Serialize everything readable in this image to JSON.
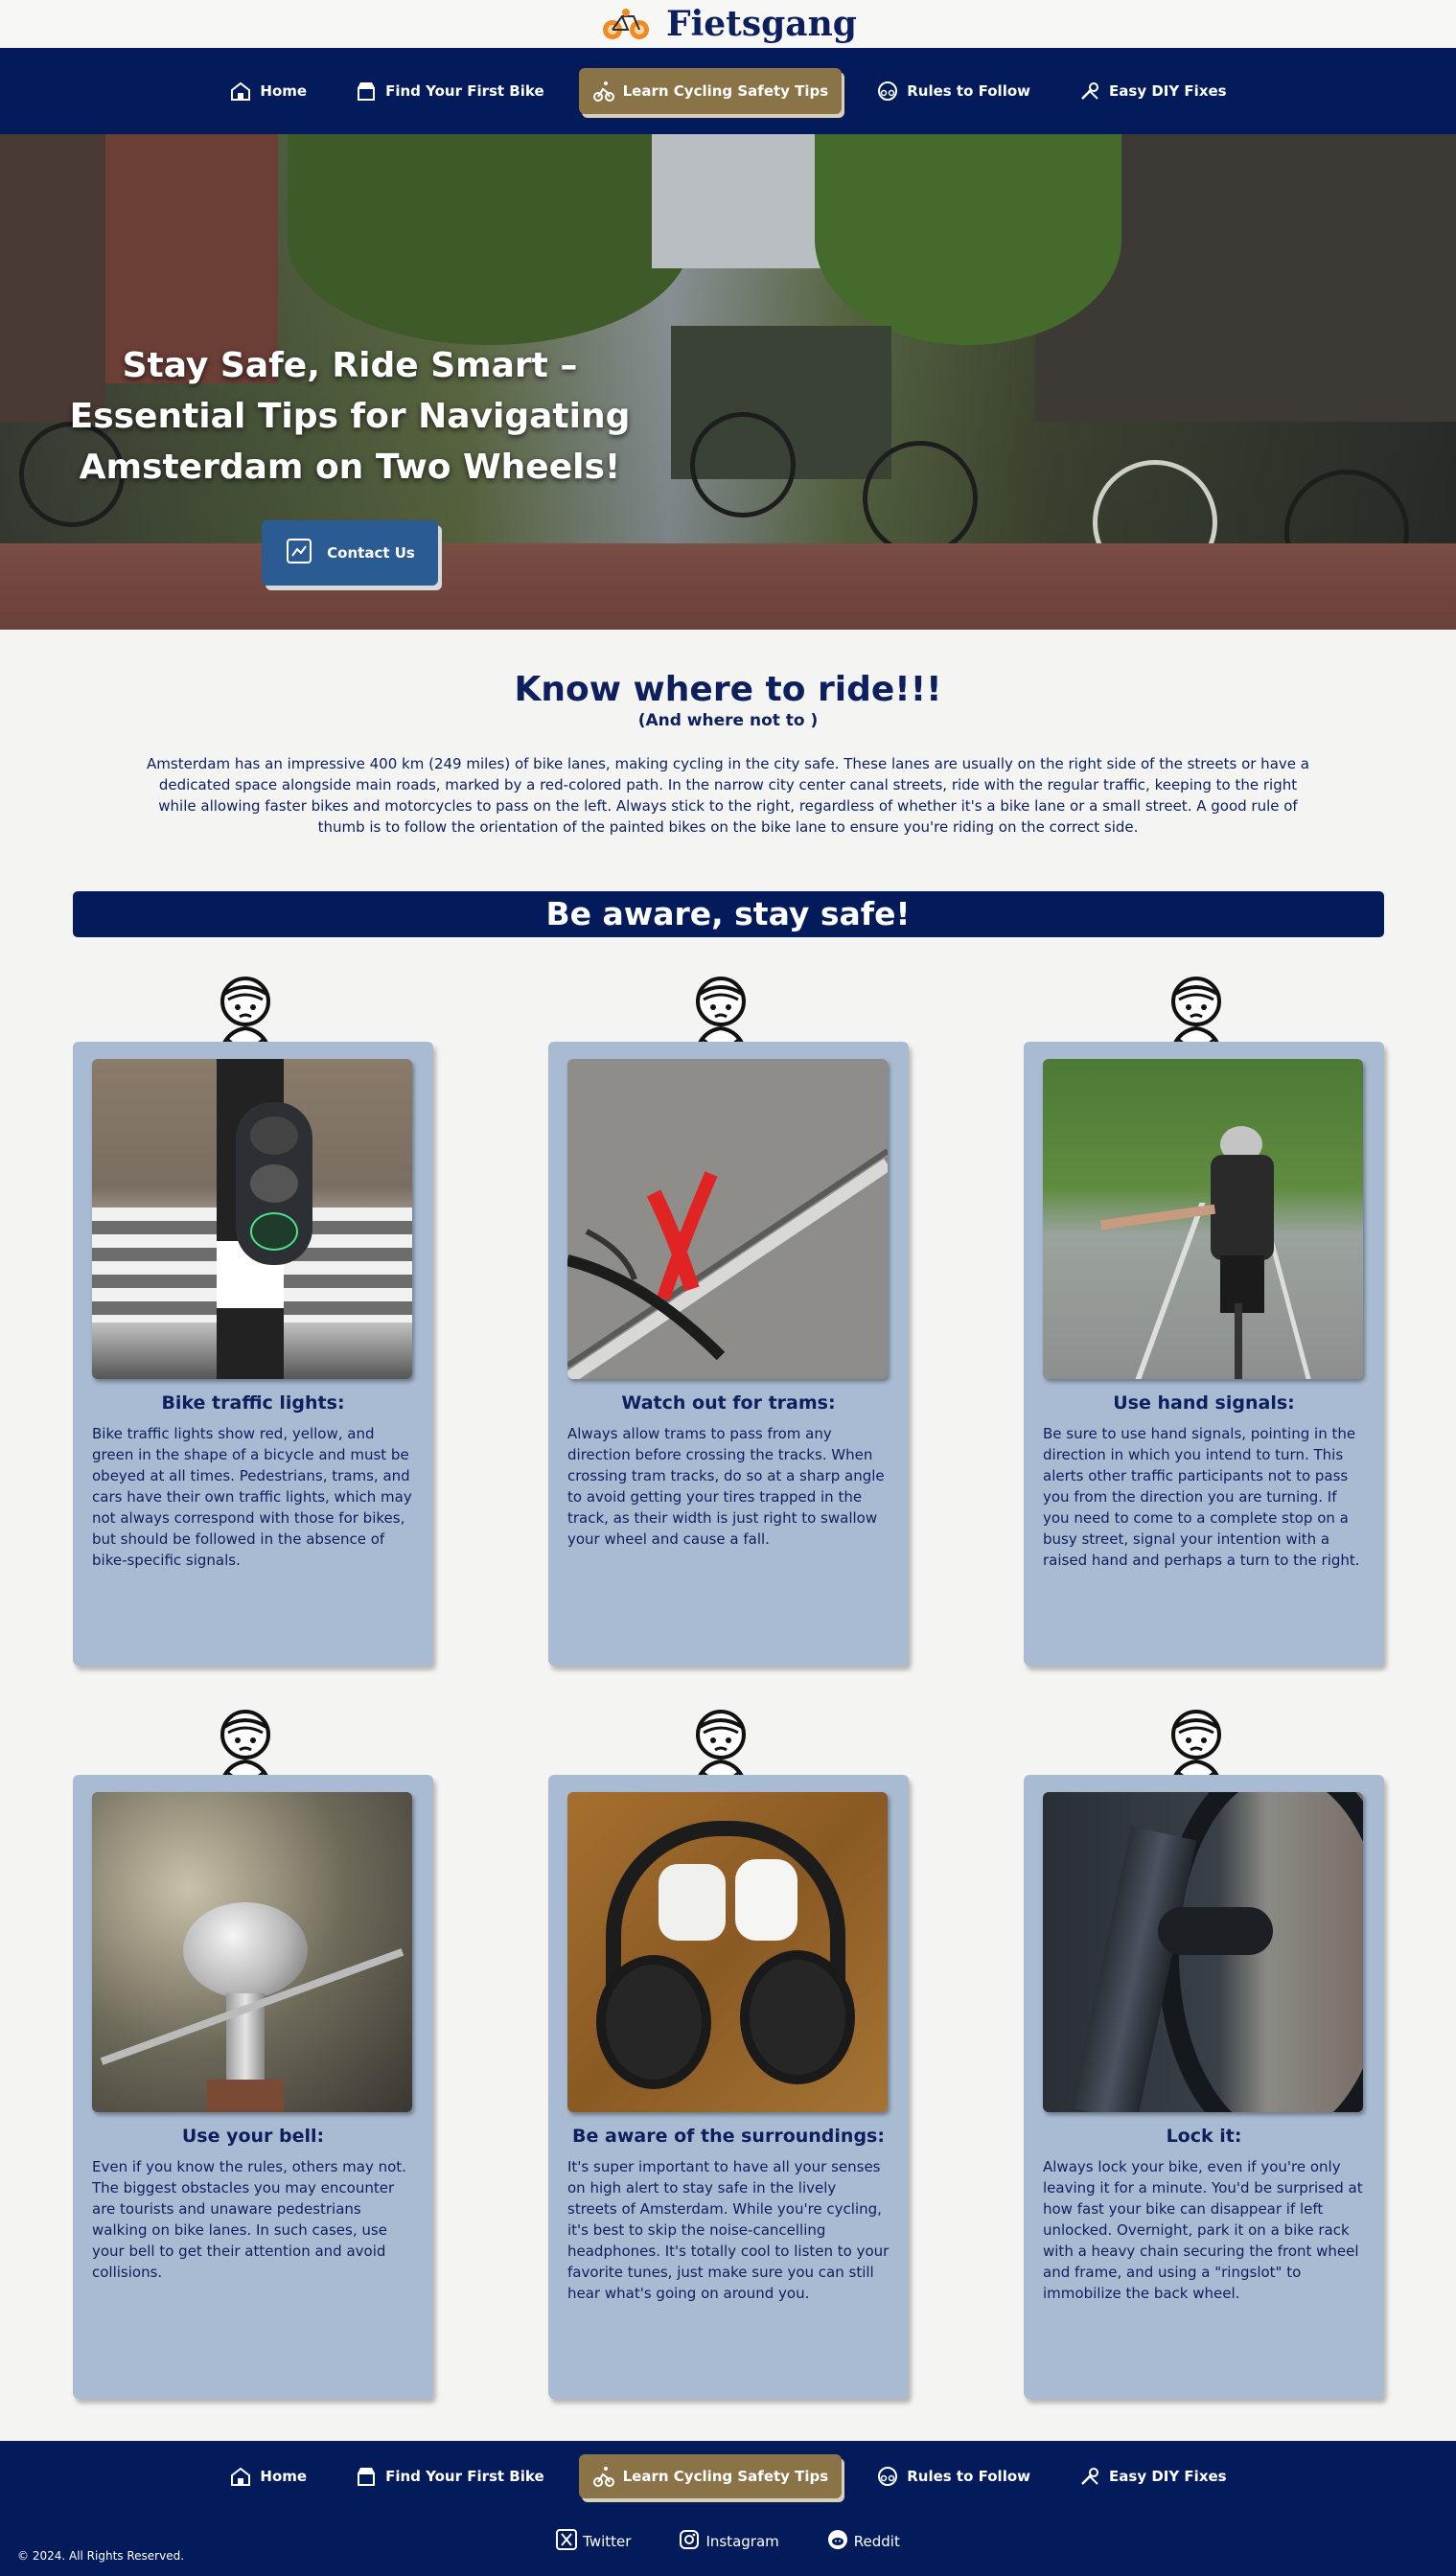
{
  "brand": {
    "name": "Fietsgang",
    "logo_icon": "orange-bicycle-logo-icon"
  },
  "nav": {
    "items": [
      {
        "label": "Home",
        "icon": "house-icon"
      },
      {
        "label": "Find Your First Bike",
        "icon": "shop-icon"
      },
      {
        "label": "Learn Cycling Safety Tips",
        "icon": "cyclist-icon",
        "active": true
      },
      {
        "label": "Rules to Follow",
        "icon": "bike-circle-icon"
      },
      {
        "label": "Easy DIY Fixes",
        "icon": "tools-icon"
      }
    ]
  },
  "hero": {
    "title": "Stay Safe, Ride Smart – Essential Tips for Navigating Amsterdam on Two Wheels!",
    "contact_label": "Contact Us"
  },
  "intro": {
    "heading": "Know where to ride!!!",
    "subheading": "(And where not to )",
    "paragraph": "Amsterdam has an impressive 400 km (249 miles) of bike lanes, making cycling in the city safe. These lanes are usually on the right side of the streets or have a dedicated space alongside main roads, marked by a red-colored path. In the narrow city center canal streets, ride with the regular traffic, keeping to the right while allowing faster bikes and motorcycles to pass on the left. Always stick to the right, regardless of whether it's a bike lane or a small street. A good rule of thumb is to follow the orientation of the painted bikes on the bike lane to ensure you're riding on the correct side."
  },
  "banner": {
    "label": "Be aware, stay safe!"
  },
  "cards": [
    {
      "title": "Bike traffic lights:",
      "text": "Bike traffic lights show red, yellow, and green in the shape of a bicycle and must be obeyed at all times. Pedestrians, trams, and cars have their own traffic lights, which may not always correspond with those for bikes, but should be followed in the absence of bike-specific signals."
    },
    {
      "title": "Watch out for trams:",
      "text": "Always allow trams to pass from any direction before crossing the tracks. When crossing tram tracks, do so at a sharp angle to avoid getting your tires trapped in the track, as their width is just right to swallow your wheel and cause a fall."
    },
    {
      "title": "Use hand signals:",
      "text": "Be sure to use hand signals, pointing in the direction in which you intend to turn. This alerts other traffic participants not to pass you from the direction you are turning. If you need to come to a complete stop on a busy street, signal your intention with a raised hand and perhaps a turn to the right."
    },
    {
      "title": "Use your bell:",
      "text": "Even if you know the rules, others may not. The biggest obstacles you may encounter are tourists and unaware pedestrians walking on bike lanes. In such cases, use your bell to get their attention and avoid collisions."
    },
    {
      "title": "Be aware of the surroundings:",
      "text": "It's super important to have all your senses on high alert to stay safe in the lively streets of Amsterdam. While you're cycling, it's best to skip the noise-cancelling headphones. It's totally cool to listen to your favorite tunes, just make sure you can still hear what's going on around you."
    },
    {
      "title": "Lock it:",
      "text": "Always lock your bike, even if you're only leaving it for a minute. You'd be surprised at how fast your bike can disappear if left unlocked. Overnight, park it on a bike rack with a heavy chain securing the front wheel and frame, and using a \"ringslot\" to immobilize the back wheel."
    }
  ],
  "footer": {
    "social": [
      {
        "label": "Twitter",
        "icon": "x-twitter-icon"
      },
      {
        "label": "Instagram",
        "icon": "instagram-icon"
      },
      {
        "label": "Reddit",
        "icon": "reddit-icon"
      }
    ],
    "copyright": "© 2024. All Rights Reserved."
  },
  "colors": {
    "navy": "#031b5a",
    "active_tab": "#8a7447",
    "card_bg": "#a9bbd2",
    "contact_btn": "#2a5b93"
  }
}
